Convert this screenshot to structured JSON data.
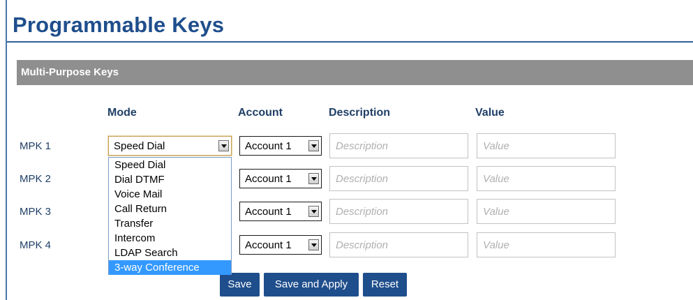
{
  "page": {
    "title": "Programmable Keys"
  },
  "section": {
    "title": "Multi-Purpose Keys"
  },
  "columns": {
    "mode": "Mode",
    "account": "Account",
    "description": "Description",
    "value": "Value"
  },
  "rows": [
    {
      "label": "MPK 1",
      "mode": "Speed Dial",
      "account": "Account 1",
      "description_placeholder": "Description",
      "value_placeholder": "Value"
    },
    {
      "label": "MPK 2",
      "mode": "",
      "account": "Account 1",
      "description_placeholder": "Description",
      "value_placeholder": "Value"
    },
    {
      "label": "MPK 3",
      "mode": "",
      "account": "Account 1",
      "description_placeholder": "Description",
      "value_placeholder": "Value"
    },
    {
      "label": "MPK 4",
      "mode": "",
      "account": "Account 1",
      "description_placeholder": "Description",
      "value_placeholder": "Value"
    }
  ],
  "mode_dropdown": {
    "options": [
      "Speed Dial",
      "Dial DTMF",
      "Voice Mail",
      "Call Return",
      "Transfer",
      "Intercom",
      "LDAP Search",
      "3-way Conference"
    ],
    "highlighted": "3-way Conference"
  },
  "buttons": {
    "save": "Save",
    "save_apply": "Save and Apply",
    "reset": "Reset"
  },
  "colors": {
    "accent": "#1f4e8c",
    "header_bg": "#8f8f8f",
    "highlight": "#3399ff"
  },
  "icons": {
    "select_arrow": "chevron-down-icon"
  }
}
